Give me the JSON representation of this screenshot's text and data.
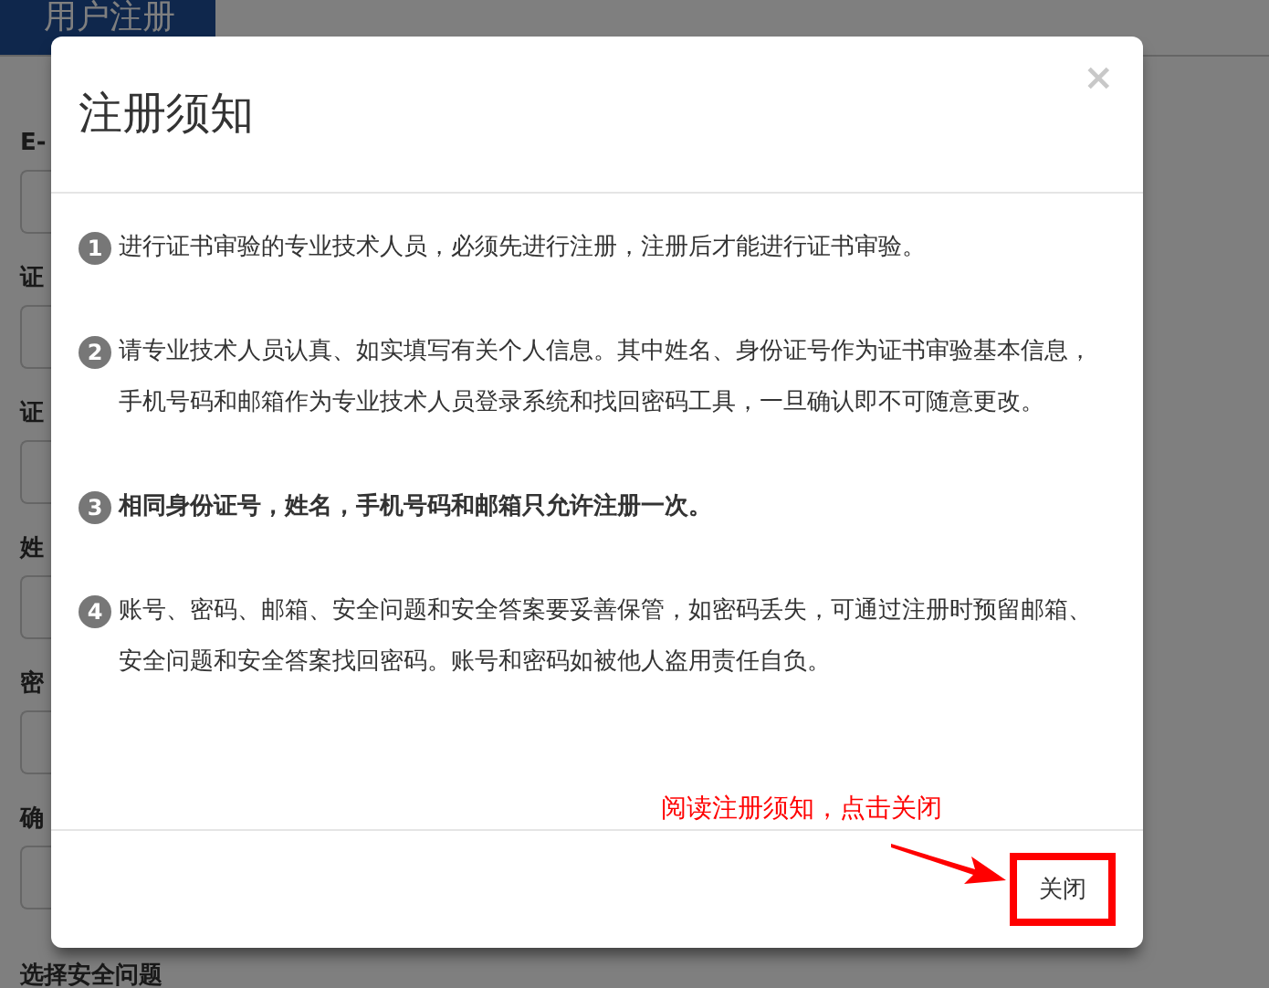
{
  "header_tab": {
    "label": "用户注册"
  },
  "form": {
    "fields": [
      {
        "label": "E-"
      },
      {
        "label": "证"
      },
      {
        "label": "证"
      },
      {
        "label": "姓"
      },
      {
        "label": "密"
      },
      {
        "label": "确"
      }
    ],
    "trailing_label": "选择安全问题"
  },
  "modal": {
    "title": "注册须知",
    "close": "×",
    "items": [
      {
        "number": "1",
        "text": "进行证书审验的专业技术人员，必须先进行注册，注册后才能进行证书审验。",
        "bold": false
      },
      {
        "number": "2",
        "text": "请专业技术人员认真、如实填写有关个人信息。其中姓名、身份证号作为证书审验基本信息，手机号码和邮箱作为专业技术人员登录系统和找回密码工具，一旦确认即不可随意更改。",
        "bold": false
      },
      {
        "number": "3",
        "text": "相同身份证号，姓名，手机号码和邮箱只允许注册一次。",
        "bold": true
      },
      {
        "number": "4",
        "text": "账号、密码、邮箱、安全问题和安全答案要妥善保管，如密码丢失，可通过注册时预留邮箱、安全问题和安全答案找回密码。账号和密码如被他人盗用责任自负。",
        "bold": false
      }
    ],
    "footer_button": "关闭"
  },
  "annotation": {
    "text": "阅读注册须知，点击关闭"
  }
}
